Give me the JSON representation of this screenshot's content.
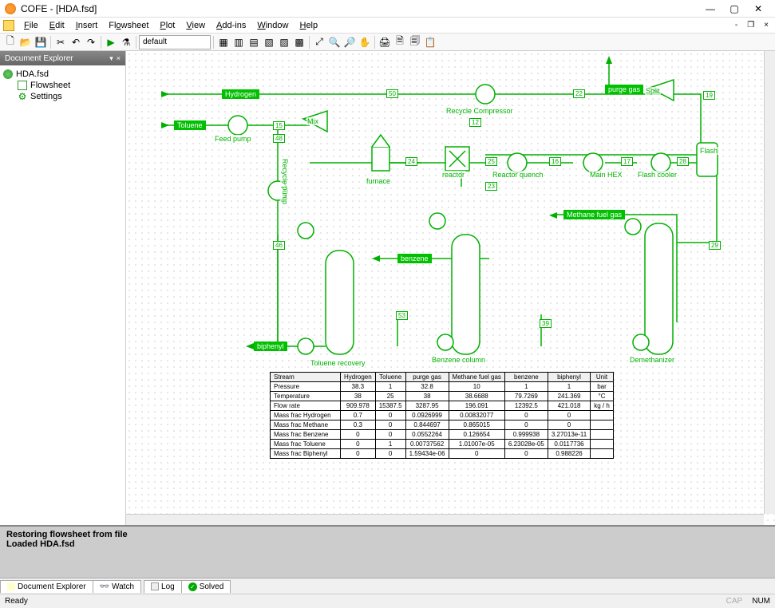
{
  "window": {
    "title": "COFE - [HDA.fsd]"
  },
  "menu": {
    "file": "File",
    "edit": "Edit",
    "insert": "Insert",
    "flowsheet": "Flowsheet",
    "plot": "Plot",
    "view": "View",
    "addins": "Add-ins",
    "window": "Window",
    "help": "Help"
  },
  "toolbar": {
    "dropdown": "default"
  },
  "explorer": {
    "title": "Document Explorer",
    "root": "HDA.fsd",
    "flowsheet": "Flowsheet",
    "settings": "Settings"
  },
  "streams": {
    "hydrogen": "Hydrogen",
    "toluene": "Toluene",
    "feedpump": "Feed pump",
    "recyclepump": "Recycle pump",
    "mix": "Mix",
    "furnace": "furnace",
    "reactor": "reactor",
    "reactorquench": "Reactor quench",
    "mainhex": "Main HEX",
    "flashcooler": "Flash cooler",
    "flash": "Flash",
    "recyclecomp": "Recycle Compressor",
    "split": "Split",
    "purgegas": "purge gas",
    "methanefuel": "Methane fuel gas",
    "demethanizer": "Demethanizer",
    "benzene": "benzene",
    "benzenecol": "Benzene column",
    "biphenyl": "biphenyl",
    "toluenerecov": "Toluene recovery"
  },
  "snum": {
    "s50": "50",
    "s22": "22",
    "s19": "19",
    "s15": "15",
    "s48": "48",
    "s12": "12",
    "s24": "24",
    "s25": "25",
    "s16": "16",
    "s17": "17",
    "s28": "28",
    "s23": "23",
    "s46": "46",
    "s53": "53",
    "s39": "39",
    "s29": "29"
  },
  "table": {
    "headers": [
      "Stream",
      "Hydrogen",
      "Toluene",
      "purge gas",
      "Methane fuel gas",
      "benzene",
      "biphenyl",
      "Unit"
    ],
    "rows": [
      [
        "Pressure",
        "38.3",
        "1",
        "32.8",
        "10",
        "1",
        "1",
        "bar"
      ],
      [
        "Temperature",
        "38",
        "25",
        "38",
        "38.6688",
        "79.7269",
        "241.369",
        "°C"
      ],
      [
        "Flow rate",
        "909.978",
        "15387.5",
        "3287.95",
        "196.091",
        "12392.5",
        "421.018",
        "kg / h"
      ],
      [
        "Mass frac Hydrogen",
        "0.7",
        "0",
        "0.0926999",
        "0.00832077",
        "0",
        "0",
        ""
      ],
      [
        "Mass frac Methane",
        "0.3",
        "0",
        "0.844697",
        "0.865015",
        "0",
        "0",
        ""
      ],
      [
        "Mass frac Benzene",
        "0",
        "0",
        "0.0552264",
        "0.126654",
        "0.999938",
        "3.27013e-11",
        ""
      ],
      [
        "Mass frac Toluene",
        "0",
        "1",
        "0.00737562",
        "1.01007e-05",
        "6.23028e-05",
        "0.0117736",
        ""
      ],
      [
        "Mass frac Biphenyl",
        "0",
        "0",
        "1.59434e-06",
        "0",
        "0",
        "0.988226",
        ""
      ]
    ]
  },
  "log": {
    "line1": "Restoring flowsheet from file",
    "line2": "Loaded HDA.fsd"
  },
  "tabs": {
    "doc_explorer": "Document Explorer",
    "watch": "Watch",
    "log": "Log",
    "solved": "Solved"
  },
  "status": {
    "ready": "Ready",
    "cap": "CAP",
    "num": "NUM"
  }
}
